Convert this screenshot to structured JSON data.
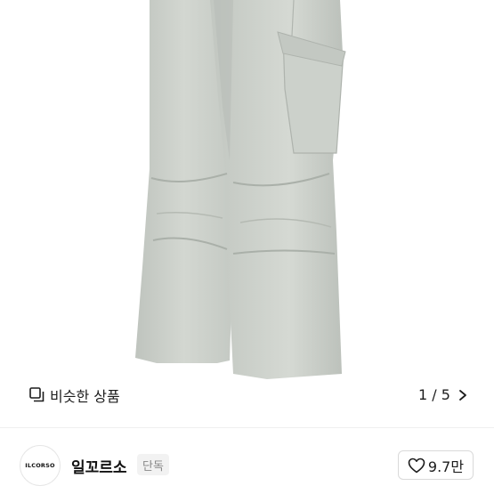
{
  "product_image": {
    "subject": "cargo-pants-photo",
    "color": "#cdd1cb"
  },
  "similar_products": {
    "label": "비슷한 상품",
    "icon": "similar-items-icon"
  },
  "pager": {
    "text": "1 / 5",
    "icon": "chevron-right-icon"
  },
  "seller": {
    "logo_text": "ILCORSO",
    "name": "일꼬르소",
    "badge": "단독"
  },
  "like": {
    "icon": "heart-icon",
    "count": "9.7만"
  }
}
